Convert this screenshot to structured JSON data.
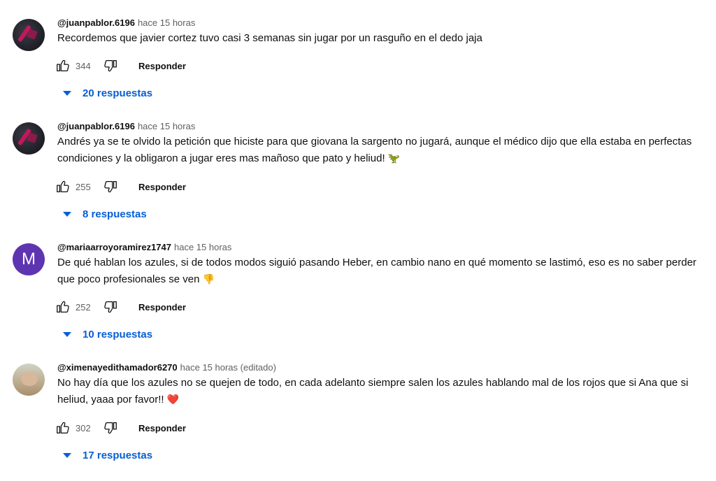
{
  "reply_label": "Responder",
  "accent_color": "#065fd4",
  "comments": [
    {
      "handle": "@juanpablor.6196",
      "time": "hace 15 horas",
      "text": "Recordemos que javier cortez tuvo casi 3 semanas sin jugar por un rasguño en el dedo jaja",
      "emoji": "",
      "likes": "344",
      "replies": "20 respuestas",
      "avatar": "dark-avatar"
    },
    {
      "handle": "@juanpablor.6196",
      "time": "hace 15 horas",
      "text": "Andrés ya se te olvido la petición que hiciste para que giovana la sargento no jugará, aunque el médico dijo que ella estaba en perfectas condiciones y la obligaron a jugar eres mas mañoso que pato y heliud!",
      "emoji": "🦖",
      "likes": "255",
      "replies": "8 respuestas",
      "avatar": "dark-avatar"
    },
    {
      "handle": "@mariaarroyoramirez1747",
      "time": "hace 15 horas",
      "text": "De qué hablan los azules, si de todos modos siguió pasando Heber, en cambio nano en qué momento se lastimó, eso es no saber perder que poco profesionales se ven",
      "emoji": "👎",
      "likes": "252",
      "replies": "10 respuestas",
      "avatar": "M"
    },
    {
      "handle": "@ximenayedithamador6270",
      "time": "hace 15 horas (editado)",
      "text": "No hay día que los azules no se quejen de todo, en cada adelanto siempre salen los azules hablando mal de los rojos que si Ana que si heliud, yaaa por favor!!",
      "emoji": "❤️",
      "likes": "302",
      "replies": "17 respuestas",
      "avatar": "photo-avatar"
    }
  ]
}
